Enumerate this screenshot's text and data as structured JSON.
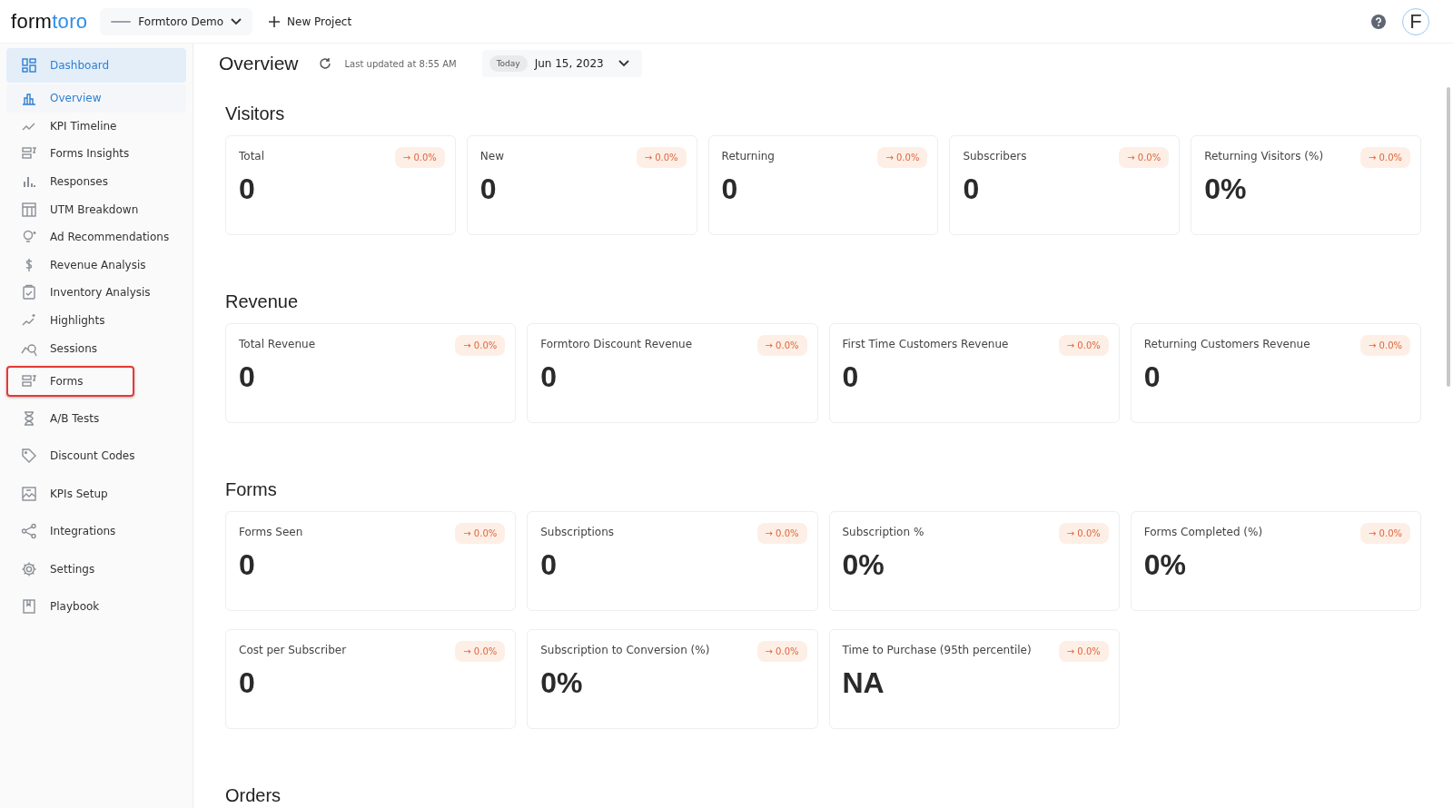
{
  "topbar": {
    "logo": {
      "dark": "form",
      "accent": "toro"
    },
    "project": "Formtoro Demo",
    "new_project": "New Project",
    "avatar": "F"
  },
  "sidebar": {
    "items": [
      {
        "kind": "main",
        "label": "Dashboard",
        "selected": true,
        "highlighted": false
      },
      {
        "kind": "sub",
        "label": "Overview",
        "selected": true,
        "highlighted": false
      },
      {
        "kind": "sub",
        "label": "KPI Timeline",
        "selected": false,
        "highlighted": false
      },
      {
        "kind": "sub",
        "label": "Forms Insights",
        "selected": false,
        "highlighted": false
      },
      {
        "kind": "sub",
        "label": "Responses",
        "selected": false,
        "highlighted": false
      },
      {
        "kind": "sub",
        "label": "UTM Breakdown",
        "selected": false,
        "highlighted": false
      },
      {
        "kind": "sub",
        "label": "Ad Recommendations",
        "selected": false,
        "highlighted": false
      },
      {
        "kind": "sub",
        "label": "Revenue Analysis",
        "selected": false,
        "highlighted": false
      },
      {
        "kind": "sub",
        "label": "Inventory Analysis",
        "selected": false,
        "highlighted": false
      },
      {
        "kind": "sub",
        "label": "Highlights",
        "selected": false,
        "highlighted": false
      },
      {
        "kind": "sub",
        "label": "Sessions",
        "selected": false,
        "highlighted": false
      },
      {
        "kind": "main",
        "label": "Forms",
        "selected": false,
        "highlighted": true
      },
      {
        "kind": "main",
        "label": "A/B Tests",
        "selected": false,
        "highlighted": false
      },
      {
        "kind": "main",
        "label": "Discount Codes",
        "selected": false,
        "highlighted": false
      },
      {
        "kind": "main",
        "label": "KPIs Setup",
        "selected": false,
        "highlighted": false
      },
      {
        "kind": "main",
        "label": "Integrations",
        "selected": false,
        "highlighted": false
      },
      {
        "kind": "main",
        "label": "Settings",
        "selected": false,
        "highlighted": false
      },
      {
        "kind": "main",
        "label": "Playbook",
        "selected": false,
        "highlighted": false
      }
    ]
  },
  "header": {
    "title": "Overview",
    "last_updated": "Last updated at 8:55 AM",
    "date_badge": "Today",
    "date": "Jun 15, 2023"
  },
  "sections": [
    {
      "title": "Visitors",
      "cards": [
        {
          "label": "Total",
          "value": "0",
          "change": "→ 0.0%"
        },
        {
          "label": "New",
          "value": "0",
          "change": "→ 0.0%"
        },
        {
          "label": "Returning",
          "value": "0",
          "change": "→ 0.0%"
        },
        {
          "label": "Subscribers",
          "value": "0",
          "change": "→ 0.0%"
        },
        {
          "label": "Returning Visitors (%)",
          "value": "0%",
          "change": "→ 0.0%"
        }
      ]
    },
    {
      "title": "Revenue",
      "cards": [
        {
          "label": "Total Revenue",
          "value": "0",
          "change": "→ 0.0%"
        },
        {
          "label": "Formtoro Discount Revenue",
          "value": "0",
          "change": "→ 0.0%"
        },
        {
          "label": "First Time Customers Revenue",
          "value": "0",
          "change": "→ 0.0%"
        },
        {
          "label": "Returning Customers Revenue",
          "value": "0",
          "change": "→ 0.0%"
        }
      ]
    },
    {
      "title": "Forms",
      "cards": [
        {
          "label": "Forms Seen",
          "value": "0",
          "change": "→ 0.0%"
        },
        {
          "label": "Subscriptions",
          "value": "0",
          "change": "→ 0.0%"
        },
        {
          "label": "Subscription %",
          "value": "0%",
          "change": "→ 0.0%"
        },
        {
          "label": "Forms Completed (%)",
          "value": "0%",
          "change": "→ 0.0%"
        },
        {
          "label": "Cost per Subscriber",
          "value": "0",
          "change": "→ 0.0%"
        },
        {
          "label": "Subscription to Conversion (%)",
          "value": "0%",
          "change": "→ 0.0%"
        },
        {
          "label": "Time to Purchase (95th percentile)",
          "value": "NA",
          "change": "→ 0.0%"
        }
      ]
    },
    {
      "title": "Orders"
    }
  ]
}
